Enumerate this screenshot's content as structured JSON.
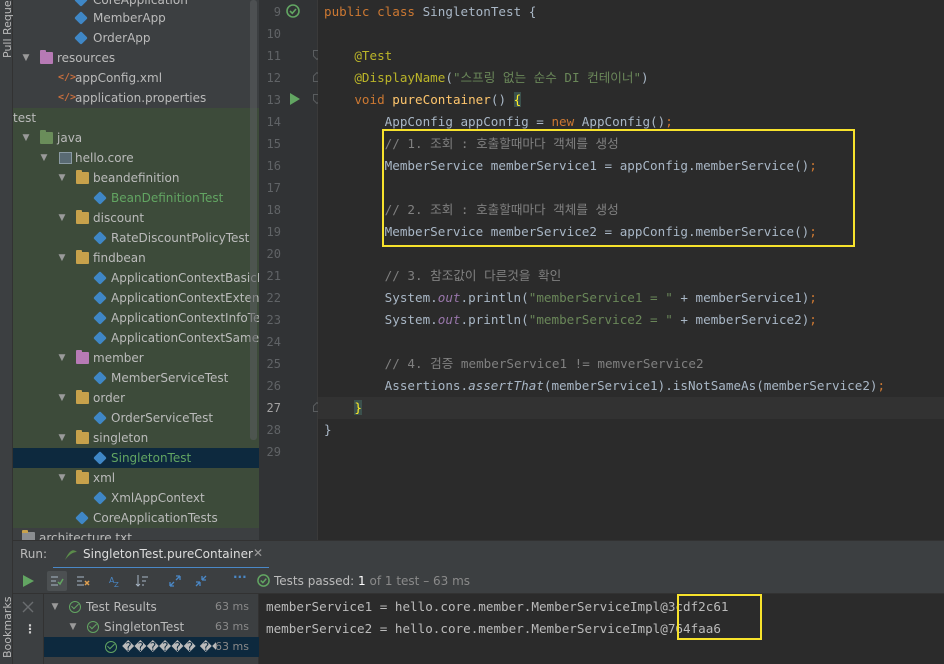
{
  "sidebar_left": {
    "pull_requests_label": "Pull Requests",
    "bookmarks_label": "Bookmarks"
  },
  "project_tree": [
    {
      "label": "CoreApplication",
      "icon": "class-icon",
      "kind": "class",
      "color": "normal"
    },
    {
      "label": "MemberApp",
      "icon": "class-icon",
      "kind": "class",
      "color": "normal"
    },
    {
      "label": "OrderApp",
      "icon": "class-icon",
      "kind": "class",
      "color": "normal"
    },
    {
      "label": "resources",
      "icon": "resources-folder-icon",
      "kind": "folder-pink",
      "color": "normal"
    },
    {
      "label": "appConfig.xml",
      "icon": "xml-file-icon",
      "kind": "xml",
      "color": "normal"
    },
    {
      "label": "application.properties",
      "icon": "properties-file-icon",
      "kind": "xml",
      "color": "normal"
    },
    {
      "label": "test",
      "icon": "",
      "kind": "none",
      "color": "normal"
    },
    {
      "label": "java",
      "icon": "test-sources-folder-icon",
      "kind": "folder-green",
      "color": "normal"
    },
    {
      "label": "hello.core",
      "icon": "package-icon",
      "kind": "pkg",
      "color": "normal"
    },
    {
      "label": "beandefinition",
      "icon": "folder-icon",
      "kind": "folder",
      "color": "normal"
    },
    {
      "label": "BeanDefinitionTest",
      "icon": "class-icon",
      "kind": "class",
      "color": "green"
    },
    {
      "label": "discount",
      "icon": "folder-icon",
      "kind": "folder",
      "color": "normal"
    },
    {
      "label": "RateDiscountPolicyTest",
      "icon": "class-icon",
      "kind": "class",
      "color": "normal"
    },
    {
      "label": "findbean",
      "icon": "folder-icon",
      "kind": "folder",
      "color": "normal"
    },
    {
      "label": "ApplicationContextBasicFi",
      "icon": "class-icon",
      "kind": "class",
      "color": "normal"
    },
    {
      "label": "ApplicationContextExtendsI",
      "icon": "class-icon",
      "kind": "class",
      "color": "normal"
    },
    {
      "label": "ApplicationContextInfoTest",
      "icon": "class-icon",
      "kind": "class",
      "color": "normal"
    },
    {
      "label": "ApplicationContextSameBe",
      "icon": "class-icon",
      "kind": "class",
      "color": "normal"
    },
    {
      "label": "member",
      "icon": "folder-icon",
      "kind": "folder-pink",
      "color": "normal"
    },
    {
      "label": "MemberServiceTest",
      "icon": "class-icon",
      "kind": "class",
      "color": "normal"
    },
    {
      "label": "order",
      "icon": "folder-icon",
      "kind": "folder",
      "color": "normal"
    },
    {
      "label": "OrderServiceTest",
      "icon": "class-icon",
      "kind": "class",
      "color": "normal"
    },
    {
      "label": "singleton",
      "icon": "folder-icon",
      "kind": "folder",
      "color": "normal"
    },
    {
      "label": "SingletonTest",
      "icon": "class-icon",
      "kind": "class",
      "color": "green"
    },
    {
      "label": "xml",
      "icon": "folder-icon",
      "kind": "folder",
      "color": "normal"
    },
    {
      "label": "XmlAppContext",
      "icon": "class-icon",
      "kind": "class",
      "color": "normal"
    },
    {
      "label": "CoreApplicationTests",
      "icon": "class-icon",
      "kind": "class",
      "color": "normal"
    },
    {
      "label": "architecture.txt",
      "icon": "text-file-icon",
      "kind": "txt",
      "color": "normal"
    }
  ],
  "editor": {
    "line_numbers": [
      "9",
      "10",
      "11",
      "12",
      "13",
      "14",
      "15",
      "16",
      "17",
      "18",
      "19",
      "20",
      "21",
      "22",
      "23",
      "24",
      "25",
      "26",
      "27",
      "28",
      "29"
    ],
    "lines": [
      "public class SingletonTest {",
      "",
      "    @Test",
      "    @DisplayName(\"스프링 없는 순수 DI 컨테이너\")",
      "    void pureContainer() {",
      "        AppConfig appConfig = new AppConfig();",
      "        // 1. 조회 : 호출할때마다 객체를 생성",
      "        MemberService memberService1 = appConfig.memberService();",
      "",
      "        // 2. 조회 : 호출할때마다 객체를 생성",
      "        MemberService memberService2 = appConfig.memberService();",
      "",
      "        // 3. 참조값이 다른것을 확인",
      "        System.out.println(\"memberService1 = \" + memberService1);",
      "        System.out.println(\"memberService2 = \" + memberService2);",
      "",
      "        // 4. 검증 memberService1 != memverService2",
      "        Assertions.assertThat(memberService1).isNotSameAs(memberService2);",
      "    }",
      "}",
      ""
    ]
  },
  "run": {
    "label": "Run:",
    "tab_title": "SingletonTest.pureContainer",
    "status": {
      "prefix": "Tests passed:",
      "count": "1",
      "suffix": "of 1 test – 63 ms"
    },
    "results": [
      {
        "label": "Test Results",
        "time": "63 ms"
      },
      {
        "label": "SingletonTest",
        "time": "63 ms"
      },
      {
        "label": "������ ��",
        "time": "63 ms"
      }
    ],
    "console": [
      "memberService1 = hello.core.member.MemberServiceImpl@3cdf2c61",
      "memberService2 = hello.core.member.MemberServiceImpl@764faa6"
    ]
  },
  "colors": {
    "highlight_box": "#f7e22c",
    "pass_green": "#62a562",
    "keyword": "#cc7832",
    "annotation": "#bbb529",
    "string": "#6a8759",
    "comment": "#808080"
  }
}
